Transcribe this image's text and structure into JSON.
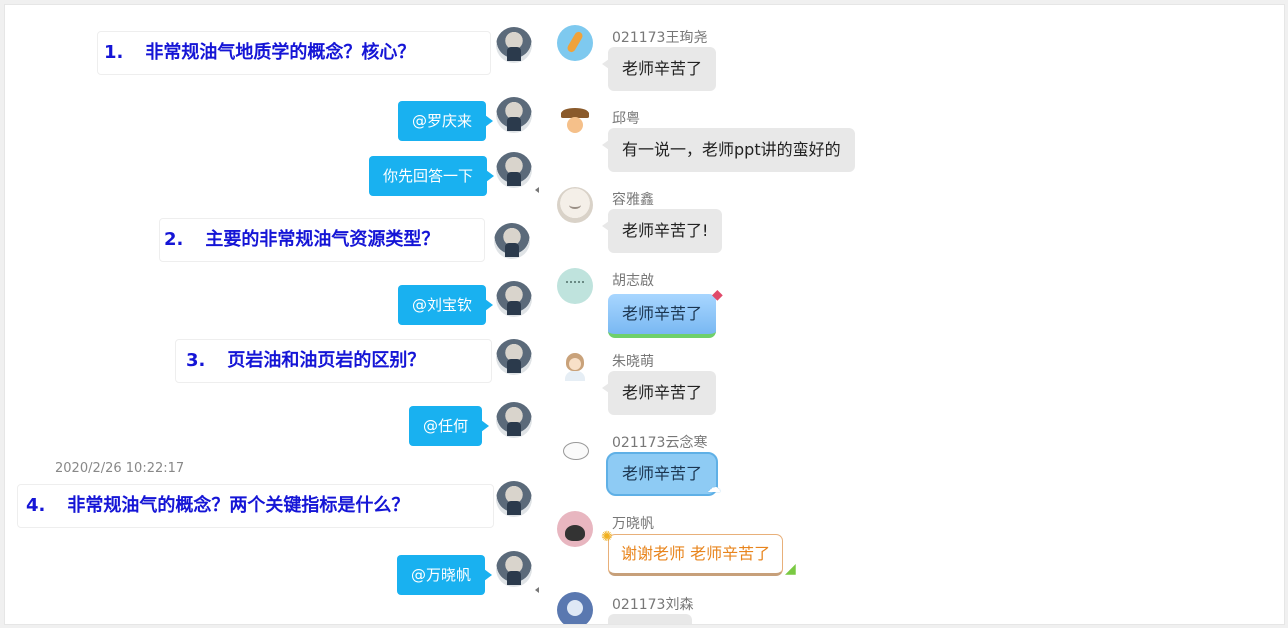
{
  "left_column": {
    "questions": [
      {
        "num": "1.",
        "text": "非常规油气地质学的概念？核心？"
      },
      {
        "num": "2.",
        "text": "主要的非常规油气资源类型？"
      },
      {
        "num": "3.",
        "text": "页岩油和油页岩的区别？"
      },
      {
        "num": "4.",
        "text": "非常规油气的概念？两个关键指标是什么？"
      }
    ],
    "mentions": [
      "@罗庆来",
      "你先回答一下",
      "@刘宝钦",
      "@任何",
      "@万晓帆"
    ],
    "timestamp": "2020/2/26 10:22:17"
  },
  "right_column": {
    "messages": [
      {
        "name": "021173王珣尧",
        "text": "老师辛苦了"
      },
      {
        "name": "邱粤",
        "text": "有一说一，老师ppt讲的蛮好的"
      },
      {
        "name": "容雅鑫",
        "text": "老师辛苦了!"
      },
      {
        "name": "胡志啟",
        "text": "老师辛苦了"
      },
      {
        "name": "朱晓萌",
        "text": "老师辛苦了"
      },
      {
        "name": "021173云念寒",
        "text": "老师辛苦了"
      },
      {
        "name": "万晓帆",
        "text": "谢谢老师 老师辛苦了"
      },
      {
        "name": "021173刘森",
        "text": ""
      }
    ]
  },
  "colors": {
    "mention_bubble": "#19b1f0",
    "question_text": "#1515d6",
    "gray_bubble": "#e8e8e8",
    "orange_text": "#e8851e"
  }
}
